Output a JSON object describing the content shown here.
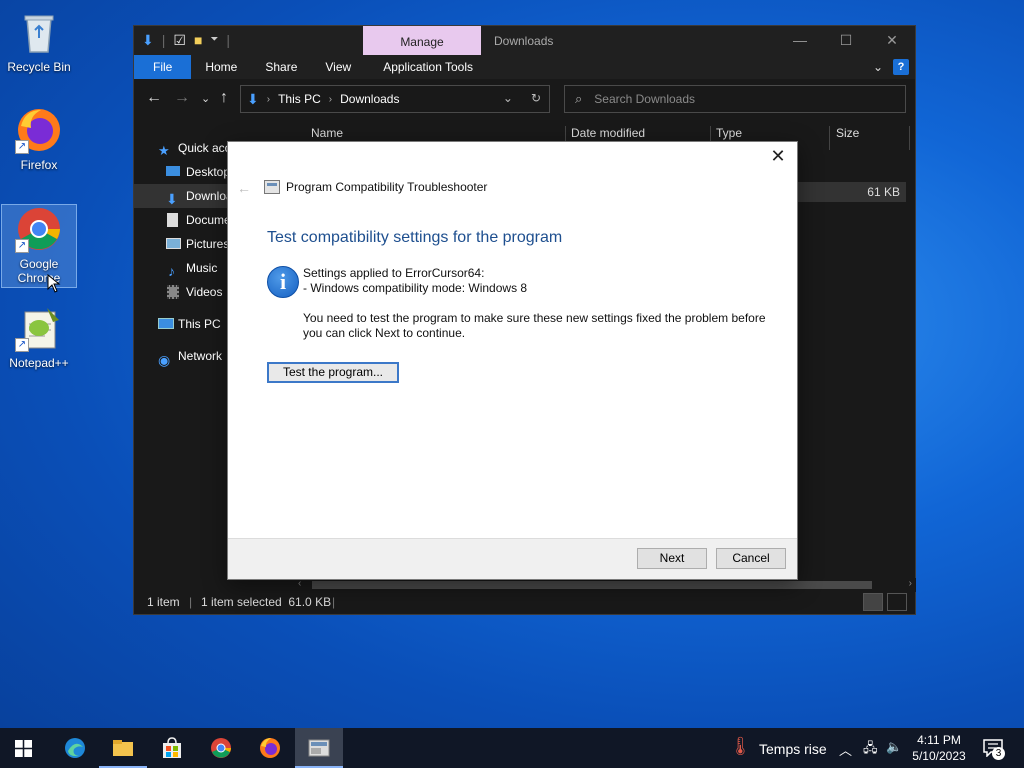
{
  "desktop": {
    "icons": [
      {
        "label": "Recycle Bin"
      },
      {
        "label": "Firefox"
      },
      {
        "label": "Google Chrome"
      },
      {
        "label": "Notepad++"
      }
    ]
  },
  "explorer": {
    "context_tab": "Manage",
    "window_title": "Downloads",
    "ribbon_tabs": [
      "File",
      "Home",
      "Share",
      "View",
      "Application Tools"
    ],
    "breadcrumb": [
      "This PC",
      "Downloads"
    ],
    "search_placeholder": "Search Downloads",
    "sidebar": [
      "Quick access",
      "Desktop",
      "Downloads",
      "Documents",
      "Pictures",
      "Music",
      "Videos",
      "This PC",
      "Network"
    ],
    "columns": [
      "Name",
      "Date modified",
      "Type",
      "Size"
    ],
    "file_size": "61 KB",
    "status": {
      "items": "1 item",
      "selected": "1 item selected  61.0 KB"
    }
  },
  "dialog": {
    "title": "Program Compatibility Troubleshooter",
    "heading": "Test compatibility settings for the program",
    "settings_line1": "Settings applied to ErrorCursor64:",
    "settings_line2": "- Windows compatibility mode: Windows 8",
    "note_line1": "You need to test the program to make sure these new settings fixed the problem before",
    "note_line2": "you can click Next to continue.",
    "test_button": "Test the program...",
    "next_button": "Next",
    "cancel_button": "Cancel"
  },
  "taskbar": {
    "weather": "Temps rise",
    "time": "4:11 PM",
    "date": "5/10/2023",
    "notification_count": "3"
  },
  "colors": {
    "accent": "#1a6fd6",
    "manage_tab": "#e8c9ee",
    "dialog_heading": "#1e4f8f"
  }
}
